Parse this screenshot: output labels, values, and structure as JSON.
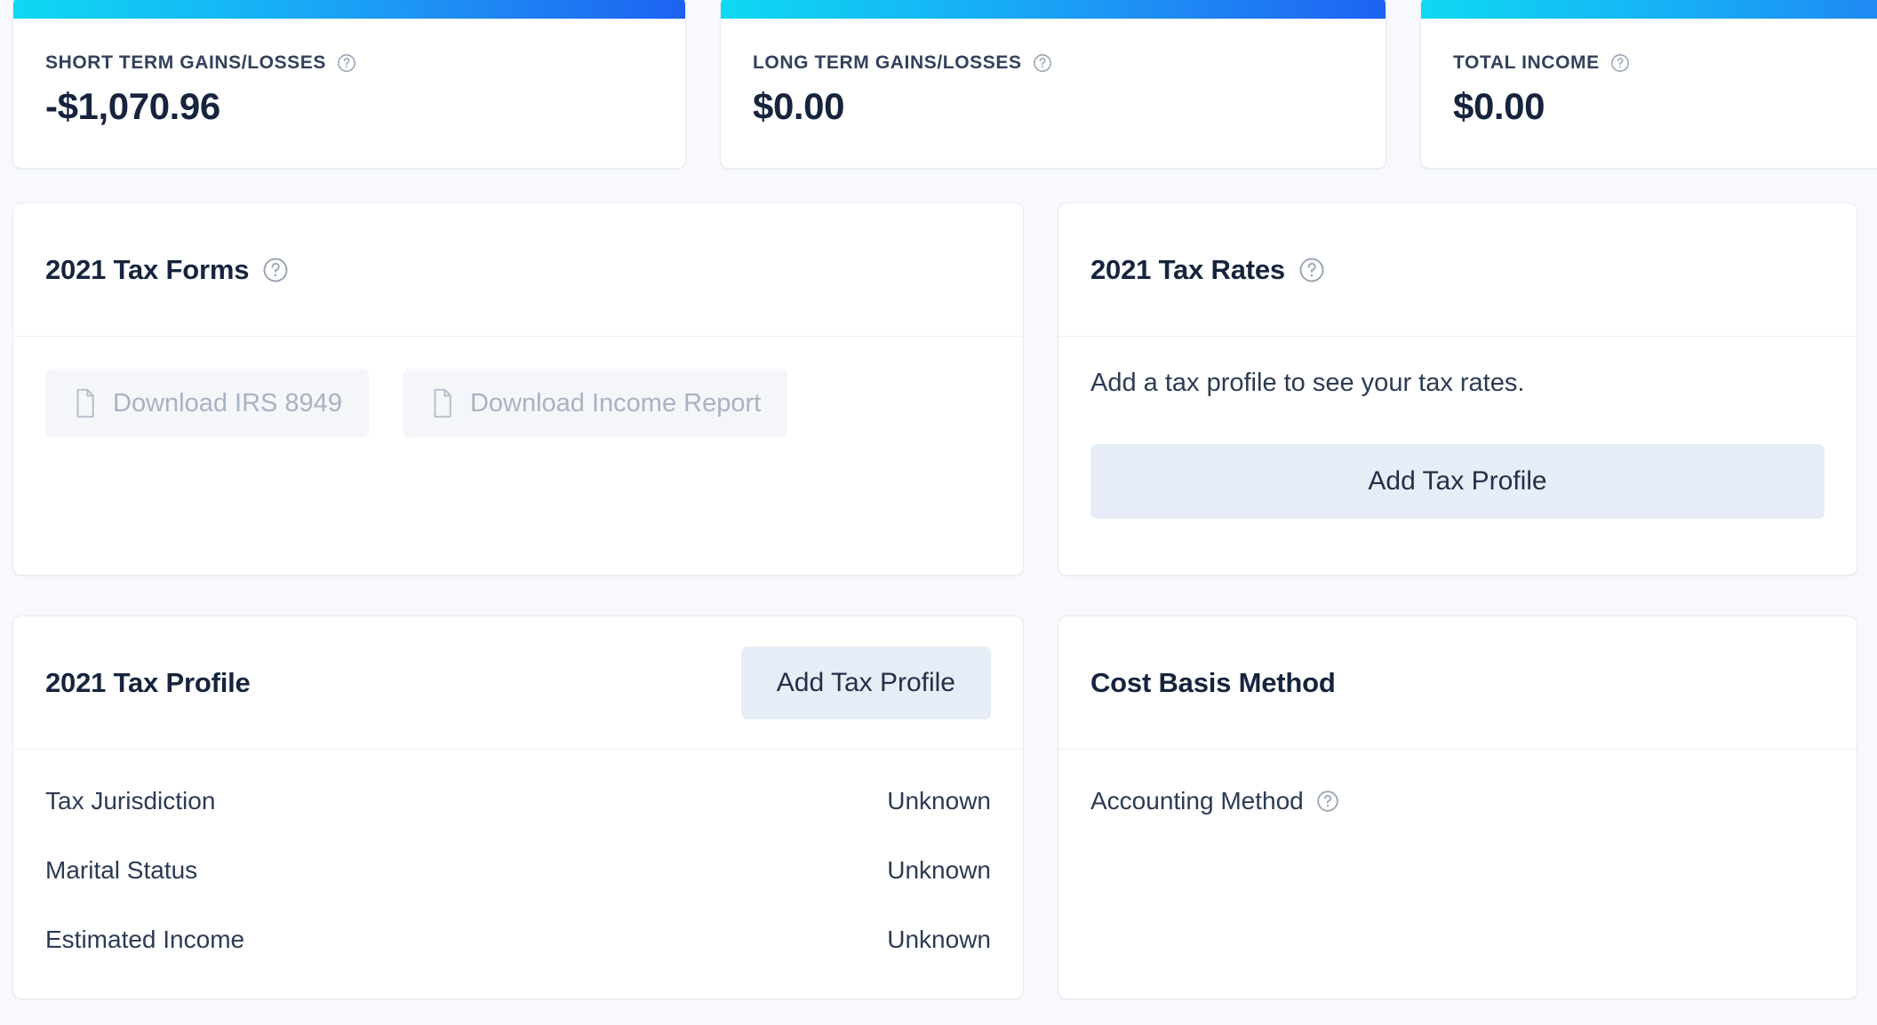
{
  "theme": {
    "accent_gradient_start": "#0fd9f2",
    "accent_gradient_end": "#1d62f2",
    "page_bg": "#f7f9fc",
    "card_bg": "#ffffff",
    "card_border": "#e7ecf3",
    "heading_color": "#16243d",
    "body_text_color": "#2c3a54",
    "disabled_text_color": "#a9b2c1",
    "soft_button_bg": "#e7edf6",
    "disabled_button_bg": "#f4f6fa"
  },
  "stats": [
    {
      "label": "SHORT TERM GAINS/LOSSES",
      "value": "-$1,070.96",
      "help_icon": "help-circle-icon"
    },
    {
      "label": "LONG TERM GAINS/LOSSES",
      "value": "$0.00",
      "help_icon": "help-circle-icon"
    },
    {
      "label": "TOTAL INCOME",
      "value": "$0.00",
      "help_icon": "help-circle-icon"
    }
  ],
  "tax_forms": {
    "title": "2021 Tax Forms",
    "help_icon": "help-circle-icon",
    "buttons": [
      {
        "label": "Download IRS 8949",
        "icon": "document-icon",
        "disabled": true
      },
      {
        "label": "Download Income Report",
        "icon": "document-icon",
        "disabled": true
      }
    ]
  },
  "tax_rates": {
    "title": "2021 Tax Rates",
    "help_icon": "help-circle-icon",
    "message": "Add a tax profile to see your tax rates.",
    "action_label": "Add Tax Profile"
  },
  "tax_profile": {
    "title": "2021 Tax Profile",
    "action_label": "Add Tax Profile",
    "rows": [
      {
        "key": "Tax Jurisdiction",
        "value": "Unknown"
      },
      {
        "key": "Marital Status",
        "value": "Unknown"
      },
      {
        "key": "Estimated Income",
        "value": "Unknown"
      }
    ]
  },
  "cost_basis": {
    "title": "Cost Basis Method",
    "rows": [
      {
        "key": "Accounting Method",
        "value": "",
        "help_icon": "help-circle-icon"
      }
    ]
  }
}
